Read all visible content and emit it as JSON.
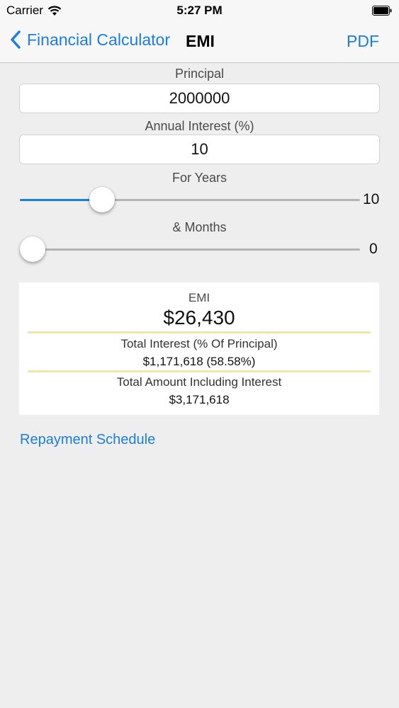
{
  "status": {
    "carrier": "Carrier",
    "time": "5:27 PM"
  },
  "nav": {
    "back_label": "Financial Calculator",
    "title": "EMI",
    "pdf_label": "PDF"
  },
  "principal": {
    "label": "Principal",
    "value": "2000000"
  },
  "interest": {
    "label": "Annual Interest (%)",
    "value": "10"
  },
  "years": {
    "label": "For Years",
    "value": "10",
    "fraction": 0.22
  },
  "months": {
    "label": "& Months",
    "value": "0",
    "fraction": 0.0
  },
  "results": {
    "emi_label": "EMI",
    "emi_value": "$26,430",
    "total_interest_label": "Total Interest (% Of Principal)",
    "total_interest_value": "$1,171,618 (58.58%)",
    "total_amount_label": "Total Amount Including Interest",
    "total_amount_value": "$3,171,618"
  },
  "repayment_link": "Repayment Schedule",
  "colors": {
    "accent": "#1a7ee0",
    "background": "#eeeeee",
    "divider": "#f3e5a8"
  }
}
